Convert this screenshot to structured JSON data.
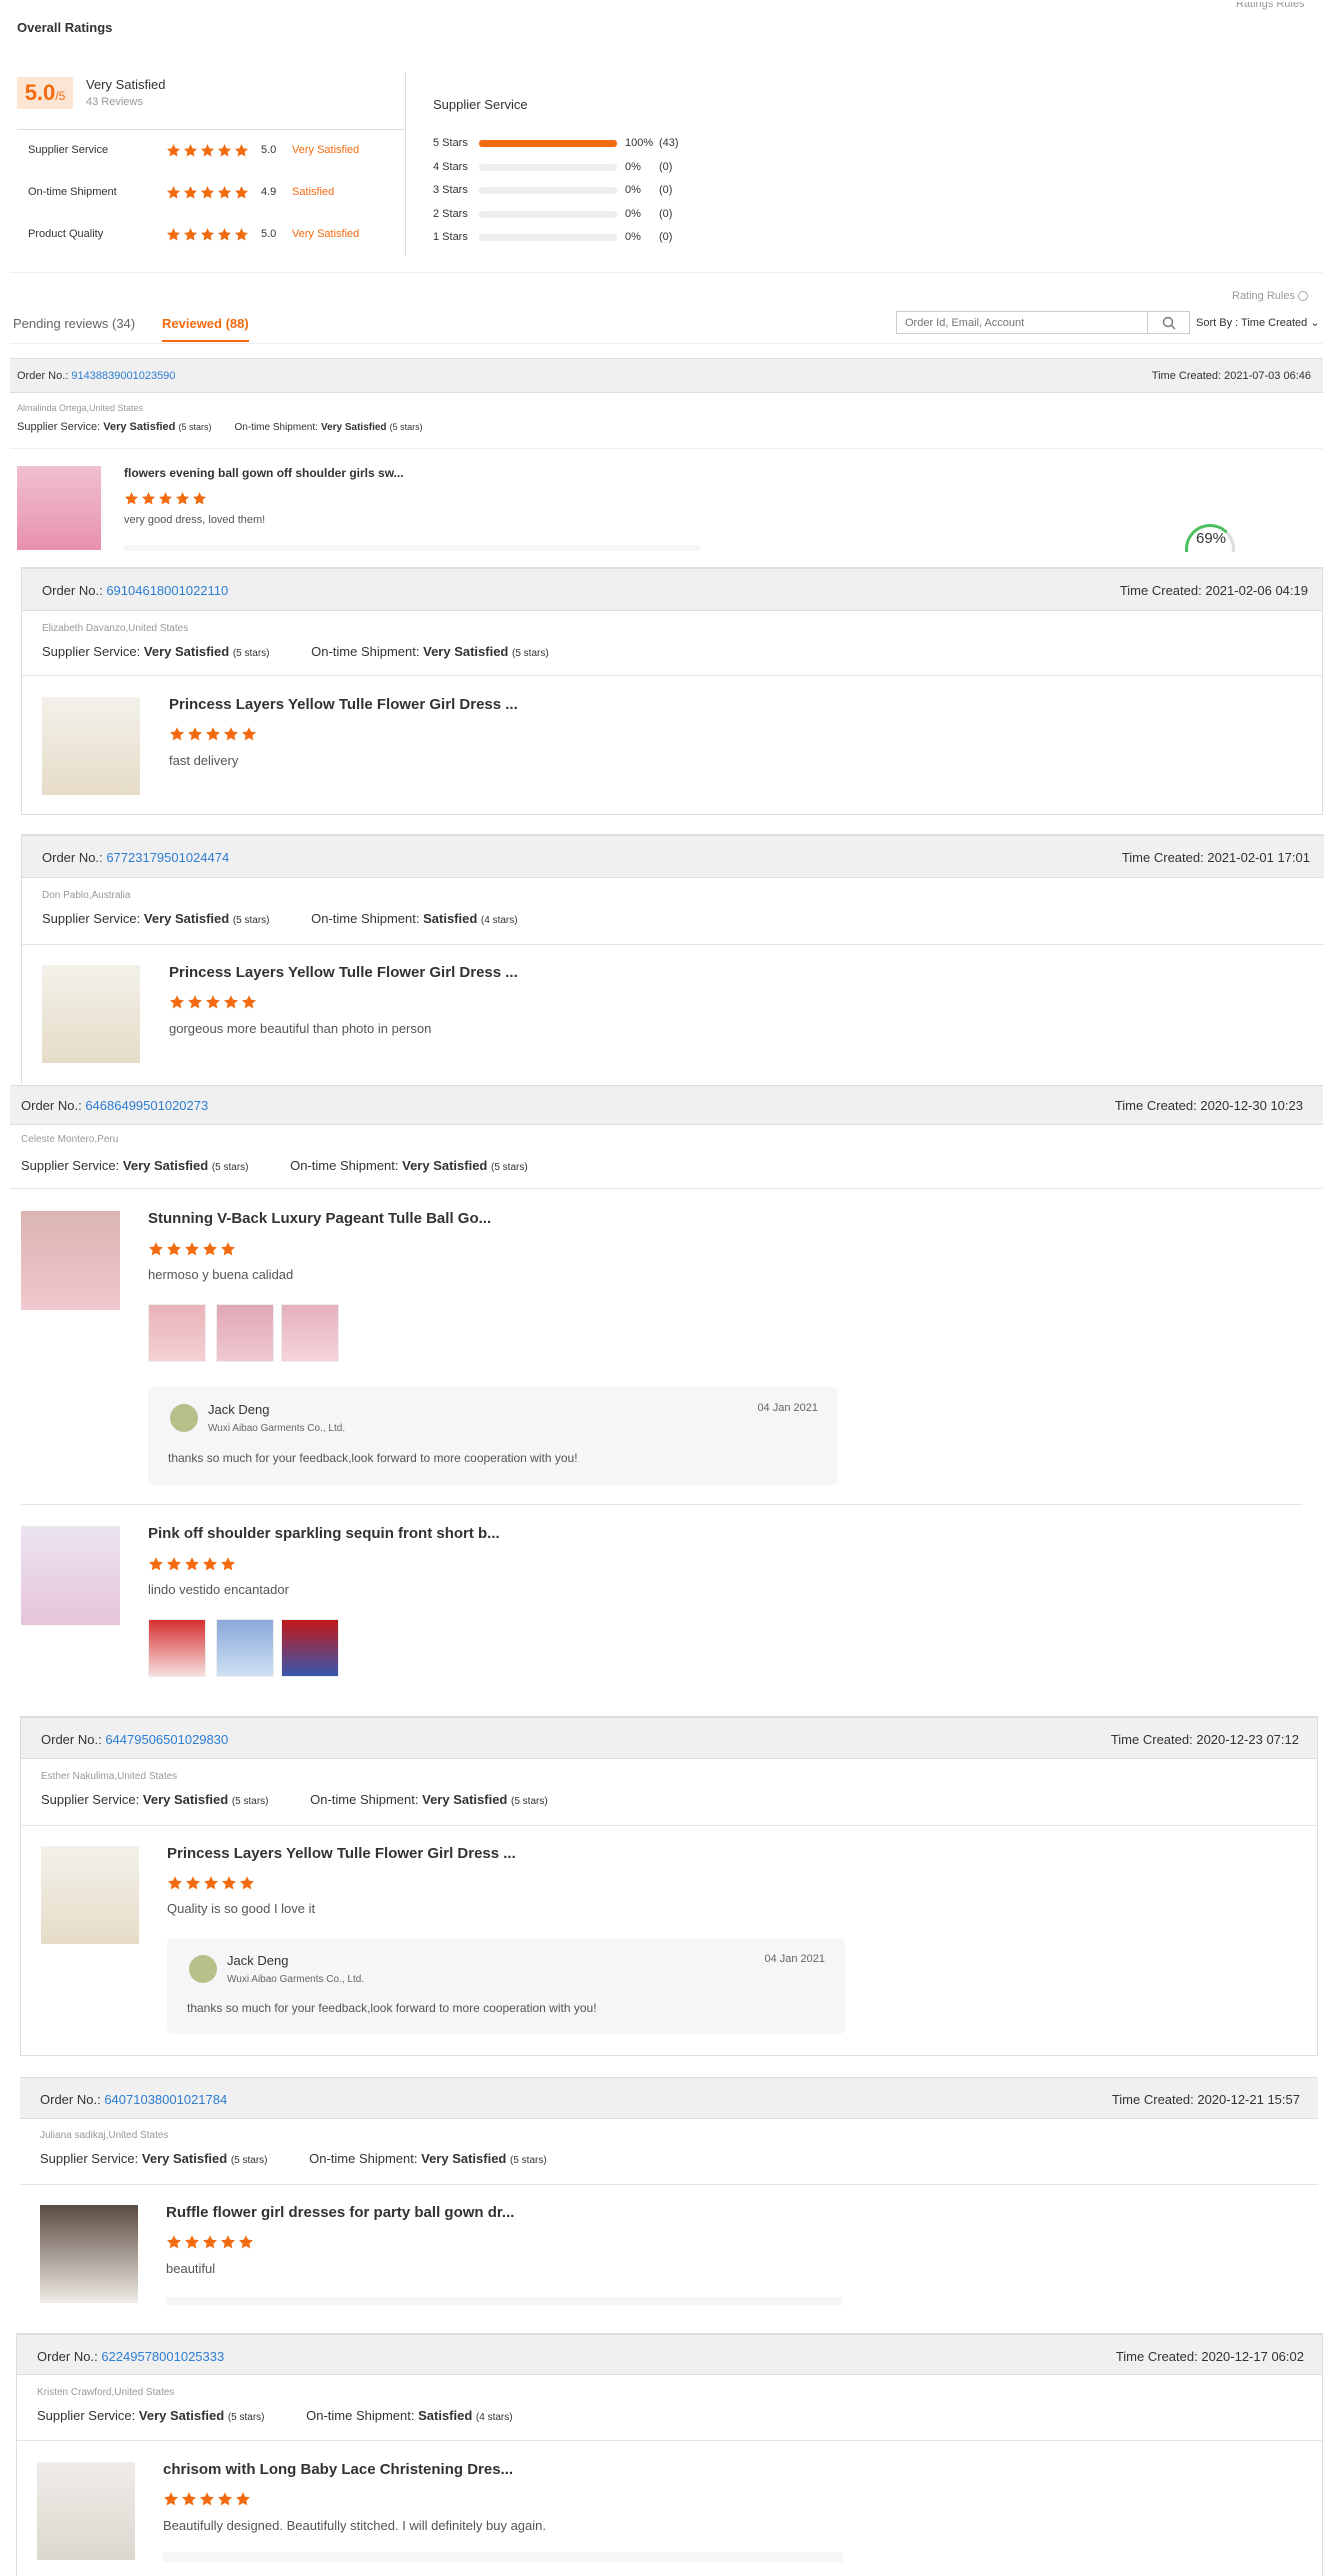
{
  "overall": {
    "title": "Overall Ratings",
    "rules_top": "Ratings Rules",
    "score": "5.0",
    "score_suffix": "/5",
    "level": "Very Satisfied",
    "reviews": "43 Reviews",
    "rows": [
      {
        "label": "Supplier Service",
        "value": "5.0",
        "level": "Very Satisfied"
      },
      {
        "label": "On-time Shipment",
        "value": "4.9",
        "level": "Satisfied"
      },
      {
        "label": "Product Quality",
        "value": "5.0",
        "level": "Very Satisfied"
      }
    ],
    "dist_title": "Supplier Service",
    "dist": [
      {
        "label": "5 Stars",
        "fill": 1.0,
        "pct": "100%",
        "count": "(43)"
      },
      {
        "label": "4 Stars",
        "fill": 0,
        "pct": "0%",
        "count": "(0)"
      },
      {
        "label": "3 Stars",
        "fill": 0,
        "pct": "0%",
        "count": "(0)"
      },
      {
        "label": "2 Stars",
        "fill": 0,
        "pct": "0%",
        "count": "(0)"
      },
      {
        "label": "1 Stars",
        "fill": 0,
        "pct": "0%",
        "count": "(0)"
      }
    ]
  },
  "toolbar": {
    "rating_rules": "Rating Rules",
    "tab_pending": "Pending reviews (34)",
    "tab_reviewed": "Reviewed (88)",
    "search_placeholder": "Order Id, Email, Account",
    "sort": "Sort By : Time Created"
  },
  "labels": {
    "order_no": "Order No.:",
    "time_created": "Time Created:",
    "supplier": "Supplier Service:",
    "shipment": "On-time Shipment:",
    "loading": "69%"
  },
  "orders": [
    {
      "no": "91438839001023590",
      "time": "2021-07-03 06:46",
      "buyer": "Almalinda Ortega,United States",
      "sup": "Very Satisfied",
      "sup_s": "(5 stars)",
      "ship": "Very Satisfied",
      "ship_s": "(5 stars)",
      "items": [
        {
          "title": "flowers evening ball gown off shoulder girls sw...",
          "comment": "very good dress, loved them!"
        }
      ]
    },
    {
      "no": "69104618001022110",
      "time": "2021-02-06 04:19",
      "buyer": "Elizabeth Davanzo,United States",
      "sup": "Very Satisfied",
      "sup_s": "(5 stars)",
      "ship": "Very Satisfied",
      "ship_s": "(5 stars)",
      "items": [
        {
          "title": "Princess Layers Yellow Tulle Flower Girl Dress ...",
          "comment": "fast delivery"
        }
      ]
    },
    {
      "no": "67723179501024474",
      "time": "2021-02-01 17:01",
      "buyer": "Don Pablo,Australia",
      "sup": "Very Satisfied",
      "sup_s": "(5 stars)",
      "ship": "Satisfied",
      "ship_s": "(4 stars)",
      "items": [
        {
          "title": "Princess Layers Yellow Tulle Flower Girl Dress ...",
          "comment": "gorgeous more beautiful than photo in person"
        }
      ]
    },
    {
      "no": "64686499501020273",
      "time": "2020-12-30 10:23",
      "buyer": "Celeste Montero,Peru",
      "sup": "Very Satisfied",
      "sup_s": "(5 stars)",
      "ship": "Very Satisfied",
      "ship_s": "(5 stars)",
      "items": [
        {
          "title": "Stunning V-Back Luxury Pageant Tulle Ball Go...",
          "comment": "hermoso y buena calidad",
          "reply": {
            "name": "Jack Deng",
            "company": "Wuxi Aibao Garments Co., Ltd.",
            "date": "04 Jan 2021",
            "text": "thanks so much for your feedback,look forward to more cooperation with you!"
          }
        },
        {
          "title": "Pink off shoulder sparkling sequin front short b...",
          "comment": "lindo vestido encantador"
        }
      ]
    },
    {
      "no": "64479506501029830",
      "time": "2020-12-23 07:12",
      "buyer": "Esther Nakulima,United States",
      "sup": "Very Satisfied",
      "sup_s": "(5 stars)",
      "ship": "Very Satisfied",
      "ship_s": "(5 stars)",
      "items": [
        {
          "title": "Princess Layers Yellow Tulle Flower Girl Dress ...",
          "comment": "Quality is so good I love it",
          "reply": {
            "name": "Jack Deng",
            "company": "Wuxi Aibao Garments Co., Ltd.",
            "date": "04 Jan 2021",
            "text": "thanks so much for your feedback,look forward to more cooperation with you!"
          }
        }
      ]
    },
    {
      "no": "64071038001021784",
      "time": "2020-12-21 15:57",
      "buyer": "Juliana sadikaj,United States",
      "sup": "Very Satisfied",
      "sup_s": "(5 stars)",
      "ship": "Very Satisfied",
      "ship_s": "(5 stars)",
      "items": [
        {
          "title": "Ruffle flower girl dresses for party ball gown dr...",
          "comment": "beautiful"
        }
      ]
    },
    {
      "no": "62249578001025333",
      "time": "2020-12-17 06:02",
      "buyer": "Kristen Crawford,United States",
      "sup": "Very Satisfied",
      "sup_s": "(5 stars)",
      "ship": "Satisfied",
      "ship_s": "(4 stars)",
      "items": [
        {
          "title": "chrisom with Long Baby Lace Christening Dres...",
          "comment": "Beautifully designed. Beautifully stitched. I will definitely buy again."
        }
      ]
    }
  ],
  "colors": {
    "accent": "#f26b10",
    "link": "#2d7dd2"
  }
}
